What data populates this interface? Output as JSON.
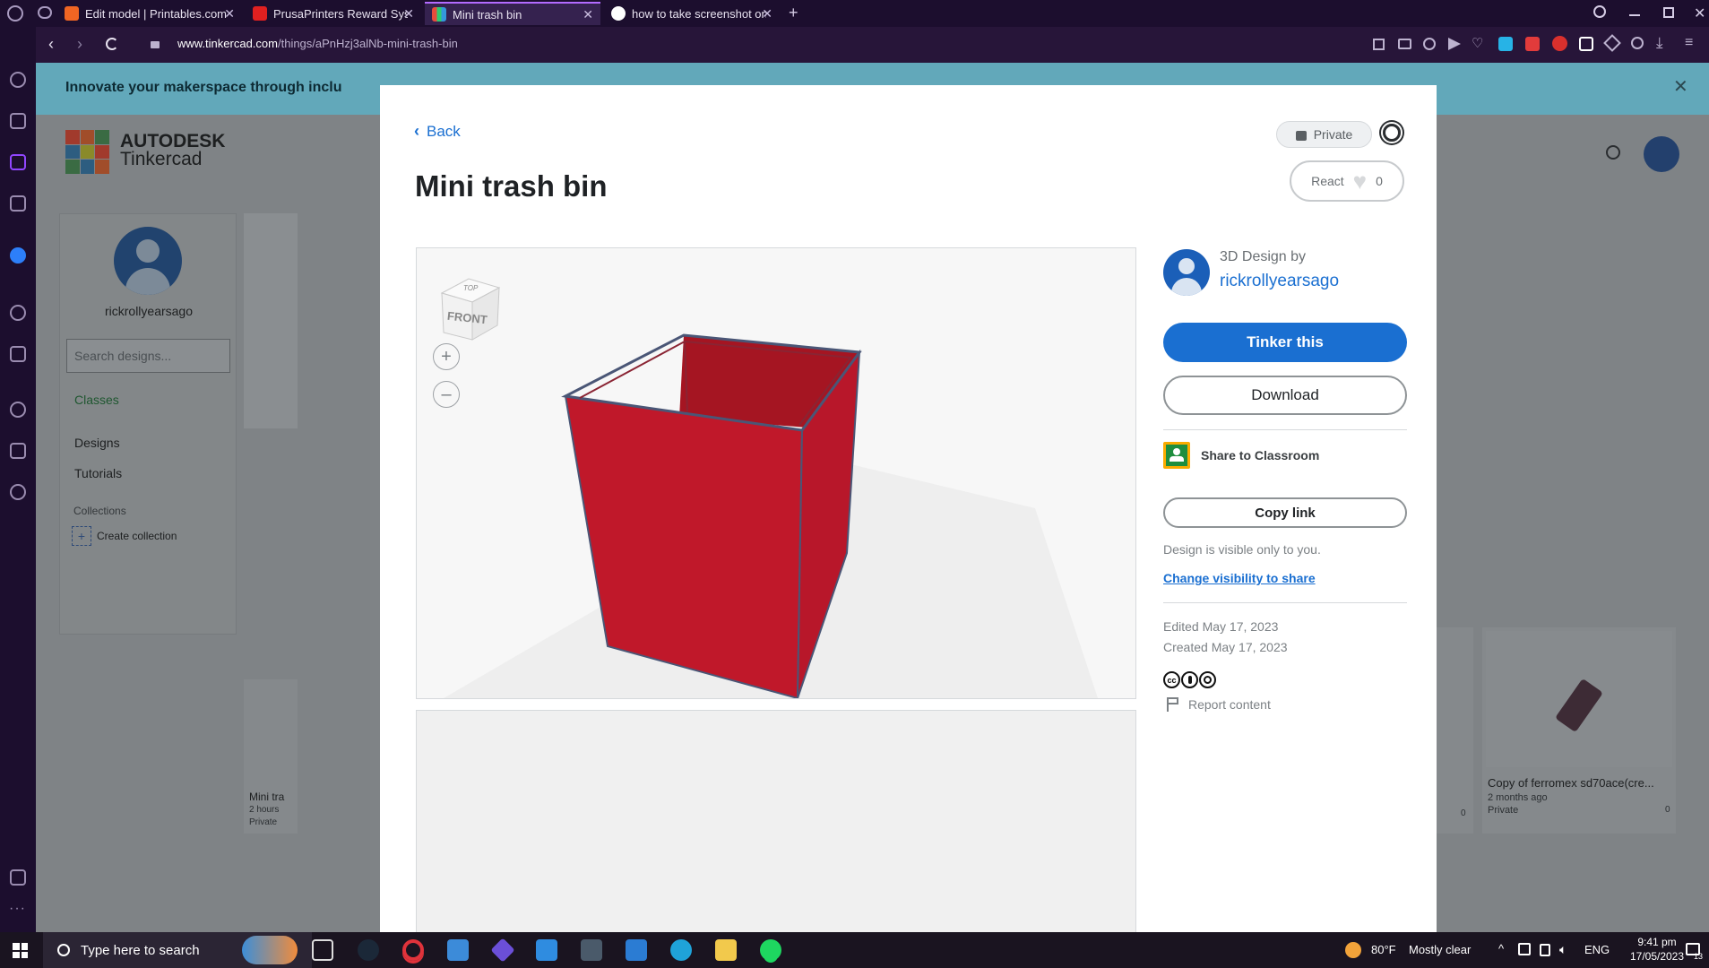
{
  "tabs": [
    {
      "title": "Edit model | Printables.com",
      "fav": "#f06523"
    },
    {
      "title": "PrusaPrinters Reward Syste",
      "fav": "#e02020"
    },
    {
      "title": "Mini trash bin",
      "fav": "#2c9ad8"
    },
    {
      "title": "how to take screenshot on",
      "fav": "#ffffff"
    }
  ],
  "address": {
    "host": "www.tinkercad.com",
    "path": "/things/aPnHzj3alNb-mini-trash-bin"
  },
  "banner": {
    "text": "Innovate your makerspace through inclu"
  },
  "background": {
    "brand_top": "AUTODESK",
    "brand_bottom": "Tinkercad",
    "username": "rickrollyearsago",
    "search_placeholder": "Search designs...",
    "nav": [
      "Classes",
      "Designs",
      "Tutorials"
    ],
    "collections_label": "Collections",
    "create_collection": "Create collection",
    "card_left": {
      "title": "Mini tra",
      "time": "2 hours",
      "privacy": "Private"
    },
    "card_right": {
      "title": "Copy of ferromex sd70ace(cre...",
      "time": "2 months ago",
      "privacy": "Private",
      "likes": "0"
    },
    "card_mid": {
      "likes": "0"
    }
  },
  "modal": {
    "back_label": "Back",
    "privacy_label": "Private",
    "title": "Mini trash bin",
    "react_label": "React",
    "react_count": "0",
    "viewcube": {
      "top": "TOP",
      "front": "FRONT"
    },
    "design_by_label": "3D Design by",
    "author": "rickrollyearsago",
    "tinker_label": "Tinker this",
    "download_label": "Download",
    "share_classroom_label": "Share to Classroom",
    "copy_link_label": "Copy link",
    "visibility_text": "Design is visible only to you.",
    "change_visibility_label": "Change visibility to share",
    "edited": "Edited May 17, 2023",
    "created": "Created May 17, 2023",
    "license_icons": "cc-by-sa-icons",
    "report_label": "Report content",
    "accent": "#1a6fd1",
    "model_color": "#c0182a"
  },
  "taskbar": {
    "search_placeholder": "Type here to search",
    "weather_temp": "80°F",
    "weather_text": "Mostly clear",
    "lang": "ENG",
    "time": "9:41 pm",
    "date": "17/05/2023",
    "notif_count": "13"
  }
}
